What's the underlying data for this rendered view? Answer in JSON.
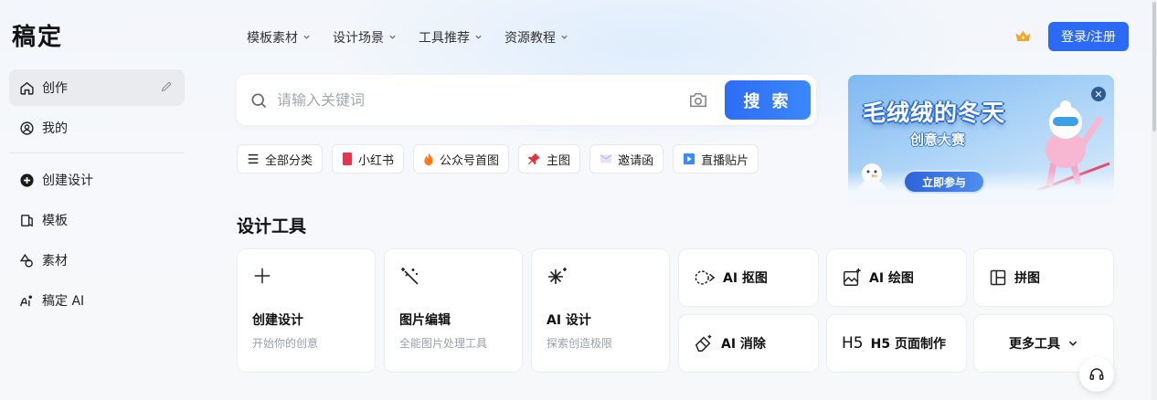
{
  "app": {
    "logo": "稿定"
  },
  "sidebar": {
    "items": [
      {
        "label": "创作",
        "icon": "home-icon",
        "active": true
      },
      {
        "label": "我的",
        "icon": "user-icon"
      },
      {
        "label": "创建设计",
        "icon": "plus-circle-icon"
      },
      {
        "label": "模板",
        "icon": "template-icon"
      },
      {
        "label": "素材",
        "icon": "shapes-icon"
      },
      {
        "label": "稿定 AI",
        "icon": "ai-icon"
      }
    ]
  },
  "topnav": {
    "items": [
      "模板素材",
      "设计场景",
      "工具推荐",
      "资源教程"
    ],
    "login_label": "登录/注册"
  },
  "search": {
    "placeholder": "请输入关键词",
    "button_label": "搜 索"
  },
  "chips": [
    {
      "label": "全部分类",
      "icon": "menu-icon"
    },
    {
      "label": "小红书",
      "icon": "book-icon"
    },
    {
      "label": "公众号首图",
      "icon": "flame-icon"
    },
    {
      "label": "主图",
      "icon": "pin-icon"
    },
    {
      "label": "邀请函",
      "icon": "envelope-icon"
    },
    {
      "label": "直播贴片",
      "icon": "play-icon"
    }
  ],
  "banner": {
    "title": "毛绒绒的冬天",
    "subtitle": "创意大赛",
    "cta": "立即参与"
  },
  "tools": {
    "section_title": "设计工具",
    "big_cards": [
      {
        "title": "创建设计",
        "subtitle": "开始你的创意",
        "icon": "plus-icon"
      },
      {
        "title": "图片编辑",
        "subtitle": "全能图片处理工具",
        "icon": "magic-wand-icon"
      },
      {
        "title": "AI 设计",
        "subtitle": "探索创造极限",
        "icon": "sparkle-icon"
      }
    ],
    "small_cards": [
      {
        "label": "AI 抠图",
        "icon": "cutout-icon"
      },
      {
        "label": "AI 绘图",
        "icon": "image-ai-icon"
      },
      {
        "label": "拼图",
        "icon": "collage-icon"
      },
      {
        "label": "AI 消除",
        "icon": "eraser-icon"
      },
      {
        "label": "H5 页面制作",
        "icon": "h5-icon",
        "icon_text": "H5"
      },
      {
        "label": "更多工具",
        "icon": "chevron-down-icon"
      }
    ]
  },
  "colors": {
    "accent": "#2b6af6",
    "background": "#f6f8fb"
  }
}
